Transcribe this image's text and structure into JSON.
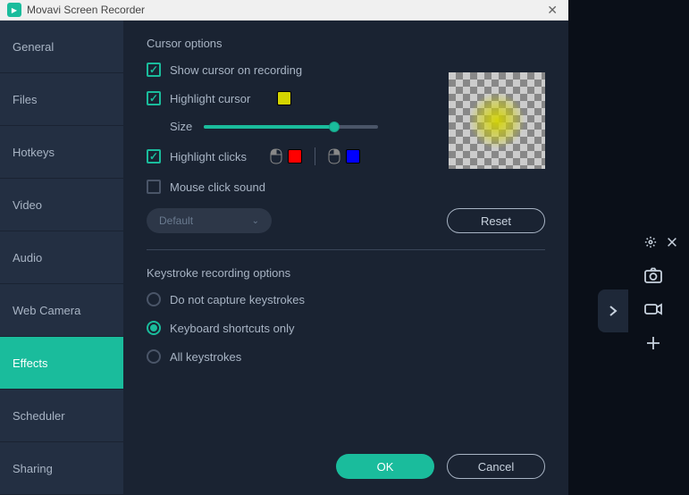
{
  "titlebar": {
    "title": "Movavi Screen Recorder"
  },
  "sidebar": {
    "items": [
      {
        "label": "General"
      },
      {
        "label": "Files"
      },
      {
        "label": "Hotkeys"
      },
      {
        "label": "Video"
      },
      {
        "label": "Audio"
      },
      {
        "label": "Web Camera"
      },
      {
        "label": "Effects"
      },
      {
        "label": "Scheduler"
      },
      {
        "label": "Sharing"
      }
    ]
  },
  "cursor": {
    "section_title": "Cursor options",
    "show_label": "Show cursor on recording",
    "highlight_label": "Highlight cursor",
    "size_label": "Size",
    "clicks_label": "Highlight clicks",
    "sound_label": "Mouse click sound",
    "select_value": "Default",
    "reset_label": "Reset"
  },
  "keystroke": {
    "section_title": "Keystroke recording options",
    "opt_none": "Do not capture keystrokes",
    "opt_shortcuts": "Keyboard shortcuts only",
    "opt_all": "All keystrokes"
  },
  "footer": {
    "ok": "OK",
    "cancel": "Cancel"
  }
}
